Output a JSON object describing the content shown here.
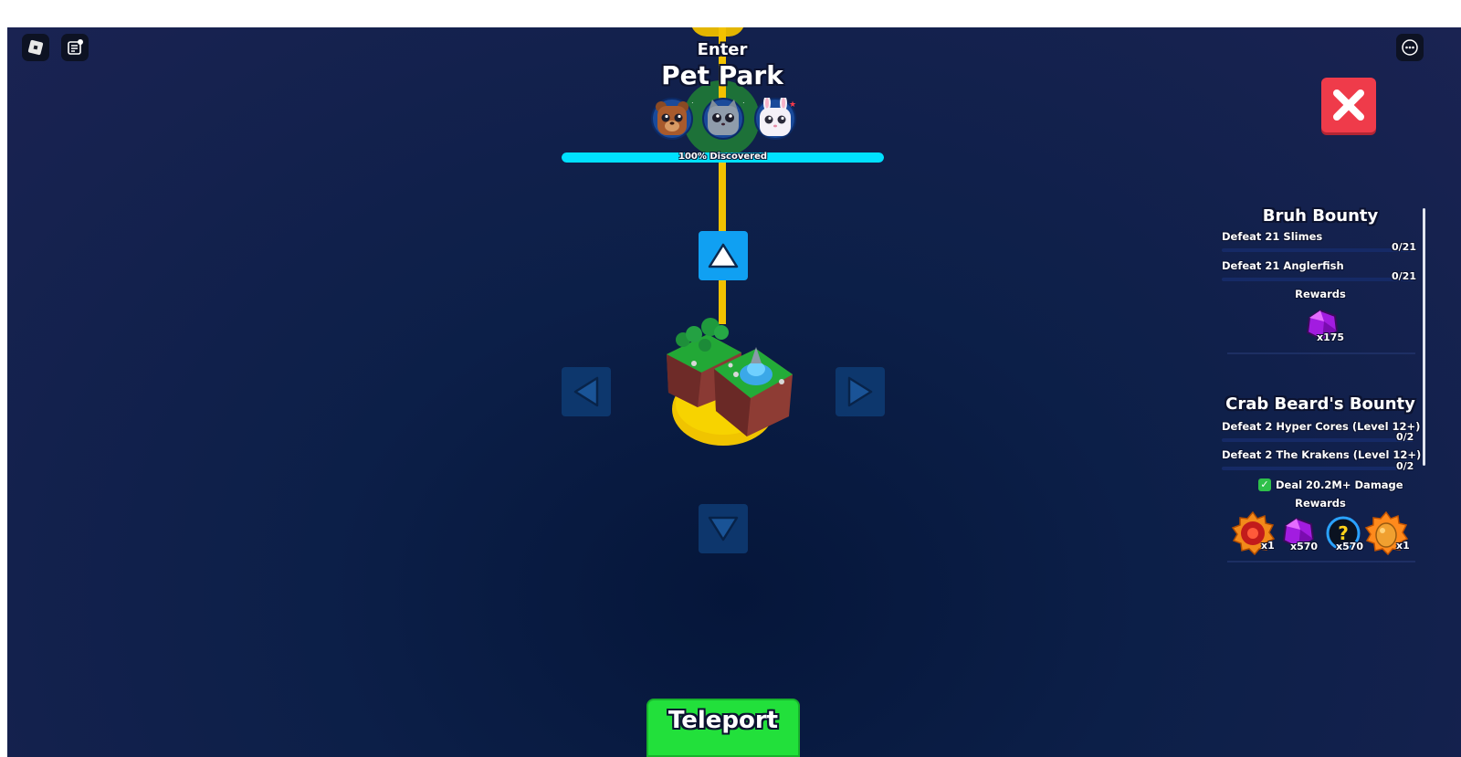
{
  "world": {
    "enter_label": "Enter",
    "area_name": "Pet Park",
    "discovered_label": "100% Discovered",
    "discovered_fraction": 1.0,
    "pets": [
      "bear-pet",
      "gray-cat-pet",
      "white-bunny-pet"
    ]
  },
  "teleport": {
    "label": "Teleport"
  },
  "bounties": [
    {
      "title": "Bruh Bounty",
      "tasks": [
        {
          "label": "Defeat 21 Slimes",
          "count": "0/21"
        },
        {
          "label": "Defeat 21 Anglerfish",
          "count": "0/21"
        }
      ],
      "rewards_label": "Rewards",
      "rewards": [
        {
          "icon": "purple-gem-icon",
          "count": "x175"
        }
      ]
    },
    {
      "title": "Crab Beard's Bounty",
      "tasks": [
        {
          "label": "Defeat 2 Hyper Cores (Level 12+)",
          "count": "0/2"
        },
        {
          "label": "Defeat 2 The Krakens (Level 12+)",
          "count": "0/2"
        }
      ],
      "completed": {
        "label": "Deal 20.2M+ Damage",
        "icon": "check-icon"
      },
      "rewards_label": "Rewards",
      "rewards": [
        {
          "icon": "red-orb-badge-icon",
          "count": "x1"
        },
        {
          "icon": "purple-gem-icon",
          "count": "x570"
        },
        {
          "icon": "mystery-orb-icon",
          "count": "x570"
        },
        {
          "icon": "orange-egg-badge-icon",
          "count": "x1"
        }
      ]
    }
  ],
  "colors": {
    "accent_cyan": "#00e1ff",
    "teleport_green": "#22e03b",
    "close_red": "#ef3b4a",
    "path_yellow": "#f2c200"
  }
}
